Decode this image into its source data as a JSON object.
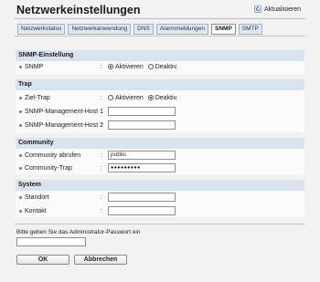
{
  "page": {
    "title": "Netzwerkeinstellungen",
    "refresh_label": "Aktualisieren"
  },
  "tabs": [
    {
      "label": "Netzwerkstatus",
      "active": false
    },
    {
      "label": "Netzwerkanwendung",
      "active": false
    },
    {
      "label": "DNS",
      "active": false
    },
    {
      "label": "Alarmmeldungen",
      "active": false
    },
    {
      "label": "SNMP",
      "active": true
    },
    {
      "label": "SMTP",
      "active": false
    }
  ],
  "snmp_section": {
    "title": "SNMP-Einstellung",
    "snmp": {
      "label": "SNMP",
      "options": [
        "Aktivieren",
        "Deaktiv."
      ],
      "selected": "Aktivieren"
    }
  },
  "trap_section": {
    "title": "Trap",
    "target_trap": {
      "label": "Ziel-Trap",
      "options": [
        "Aktivieren",
        "Deaktiv."
      ],
      "selected": "Deaktiv."
    },
    "host1": {
      "label": "SNMP-Management-Host 1",
      "value": ""
    },
    "host2": {
      "label": "SNMP-Management-Host 2",
      "value": ""
    }
  },
  "community_section": {
    "title": "Community",
    "get_community": {
      "label": "Community abrufen",
      "value": "public"
    },
    "trap_community": {
      "label": "Community-Trap",
      "value": "●●●●●●●●●"
    }
  },
  "system_section": {
    "title": "System",
    "location": {
      "label": "Standort",
      "value": ""
    },
    "contact": {
      "label": "Kontakt",
      "value": ""
    }
  },
  "footer": {
    "password_prompt": "Bitte geben Sie das Administrator-Passwort ein",
    "ok_label": "OK",
    "cancel_label": "Abbrechen"
  },
  "colors": {
    "section_header_bg": "#d9e3ee",
    "tab_bg": "#dfe7ef",
    "page_bg": "#f2f2f2"
  },
  "icons": {
    "refresh": "refresh-icon",
    "row_bullet": "bullet-icon"
  }
}
